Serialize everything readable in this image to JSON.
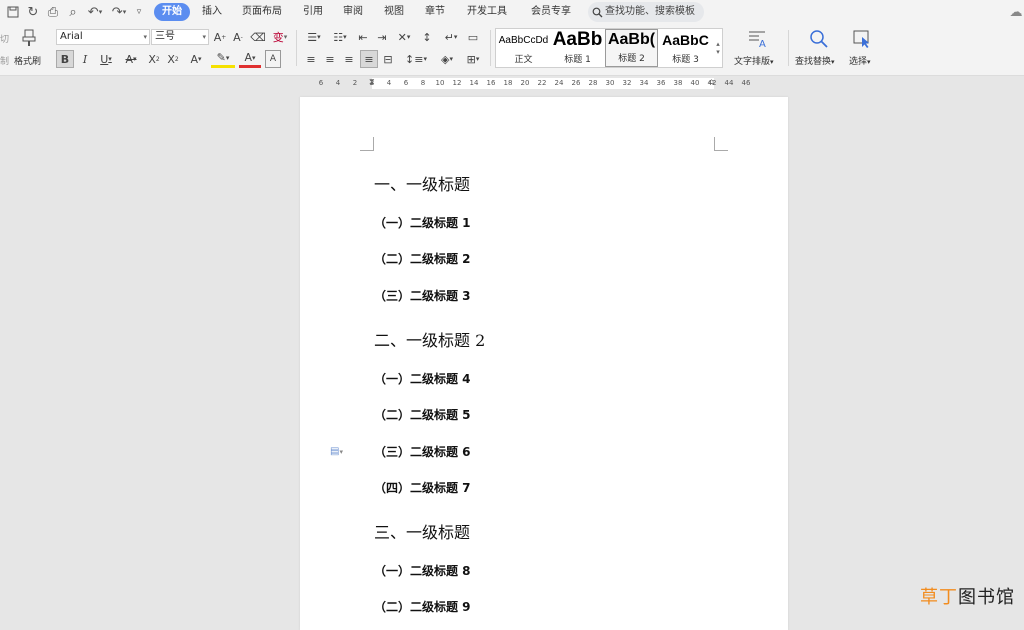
{
  "quick_access": [
    "save-icon",
    "redo-icon",
    "print-icon",
    "print-preview-icon",
    "undo-icon",
    "redo-arrow-icon",
    "customize-icon"
  ],
  "menu": {
    "tabs": [
      "开始",
      "插入",
      "页面布局",
      "引用",
      "审阅",
      "视图",
      "章节",
      "开发工具",
      "会员专享"
    ],
    "active": "开始"
  },
  "search": {
    "placeholder": "查找功能、搜索模板"
  },
  "ribbon": {
    "cut_label": "切",
    "copy_label": "制",
    "format_painter_label": "格式刷",
    "font_name": "Arial",
    "font_size": "三号",
    "styles": [
      {
        "preview": "AaBbCcDd",
        "name": "正文"
      },
      {
        "preview": "AaBb",
        "name": "标题 1"
      },
      {
        "preview": "AaBb(",
        "name": "标题 2"
      },
      {
        "preview": "AaBbC",
        "name": "标题 3"
      }
    ],
    "selected_style": "标题 2",
    "text_layout_label": "文字排版",
    "find_replace_label": "查找替换",
    "select_label": "选择"
  },
  "ruler_ticks": [
    "6",
    "4",
    "2",
    "2",
    "4",
    "6",
    "8",
    "10",
    "12",
    "14",
    "16",
    "18",
    "20",
    "22",
    "24",
    "26",
    "28",
    "30",
    "32",
    "34",
    "36",
    "38",
    "40",
    "42",
    "44",
    "46"
  ],
  "document": {
    "headings": [
      {
        "level": 1,
        "text": "一、一级标题"
      },
      {
        "level": 2,
        "text": "（一）二级标题 1"
      },
      {
        "level": 2,
        "text": "（二）二级标题 2"
      },
      {
        "level": 2,
        "text": "（三）二级标题 3"
      },
      {
        "level": 1,
        "text": "二、一级标题 2"
      },
      {
        "level": 2,
        "text": "（一）二级标题 4"
      },
      {
        "level": 2,
        "text": "（二）二级标题 5"
      },
      {
        "level": 2,
        "text": "（三）二级标题 6"
      },
      {
        "level": 2,
        "text": "（四）二级标题 7"
      },
      {
        "level": 1,
        "text": "三、一级标题"
      },
      {
        "level": 2,
        "text": "（一）二级标题 8"
      },
      {
        "level": 2,
        "text": "（二）二级标题 9"
      }
    ]
  },
  "watermark": {
    "accent": "草丁",
    "rest": "图书馆"
  },
  "colors": {
    "accent": "#5b8df0",
    "watermark_accent": "#f28c1e"
  }
}
